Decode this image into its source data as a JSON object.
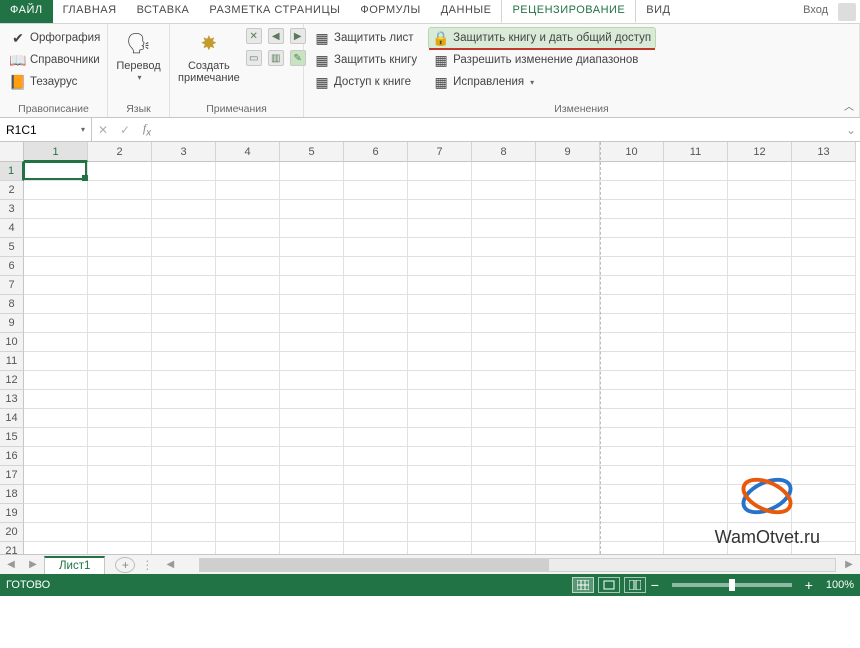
{
  "tabs": {
    "file": "ФАЙЛ",
    "items": [
      "ГЛАВНАЯ",
      "ВСТАВКА",
      "РАЗМЕТКА СТРАНИЦЫ",
      "ФОРМУЛЫ",
      "ДАННЫЕ",
      "РЕЦЕНЗИРОВАНИЕ",
      "ВИД"
    ],
    "active_index": 5,
    "signin": "Вход"
  },
  "ribbon": {
    "proofing": {
      "label": "Правописание",
      "spellcheck": "Орфография",
      "research": "Справочники",
      "thesaurus": "Тезаурус"
    },
    "language": {
      "label": "Язык",
      "translate": "Перевод"
    },
    "comments": {
      "label": "Примечания",
      "new": "Создать примечание"
    },
    "changes": {
      "label": "Изменения",
      "protect_sheet": "Защитить лист",
      "protect_workbook": "Защитить книгу",
      "share_workbook": "Доступ к книге",
      "protect_share": "Защитить книгу и дать общий доступ",
      "allow_ranges": "Разрешить изменение диапазонов",
      "track_changes": "Исправления"
    }
  },
  "formula_bar": {
    "name": "R1C1",
    "formula": ""
  },
  "grid": {
    "columns": [
      "1",
      "2",
      "3",
      "4",
      "5",
      "6",
      "7",
      "8",
      "9",
      "10",
      "11",
      "12",
      "13"
    ],
    "rows": [
      "1",
      "2",
      "3",
      "4",
      "5",
      "6",
      "7",
      "8",
      "9",
      "10",
      "11",
      "12",
      "13",
      "14",
      "15",
      "16",
      "17",
      "18",
      "19",
      "20",
      "21"
    ],
    "active_cell": {
      "row": 0,
      "col": 0
    }
  },
  "sheets": {
    "active": "Лист1"
  },
  "status": {
    "ready": "ГОТОВО",
    "zoom": "100%"
  },
  "watermark": "WamOtvet.ru"
}
